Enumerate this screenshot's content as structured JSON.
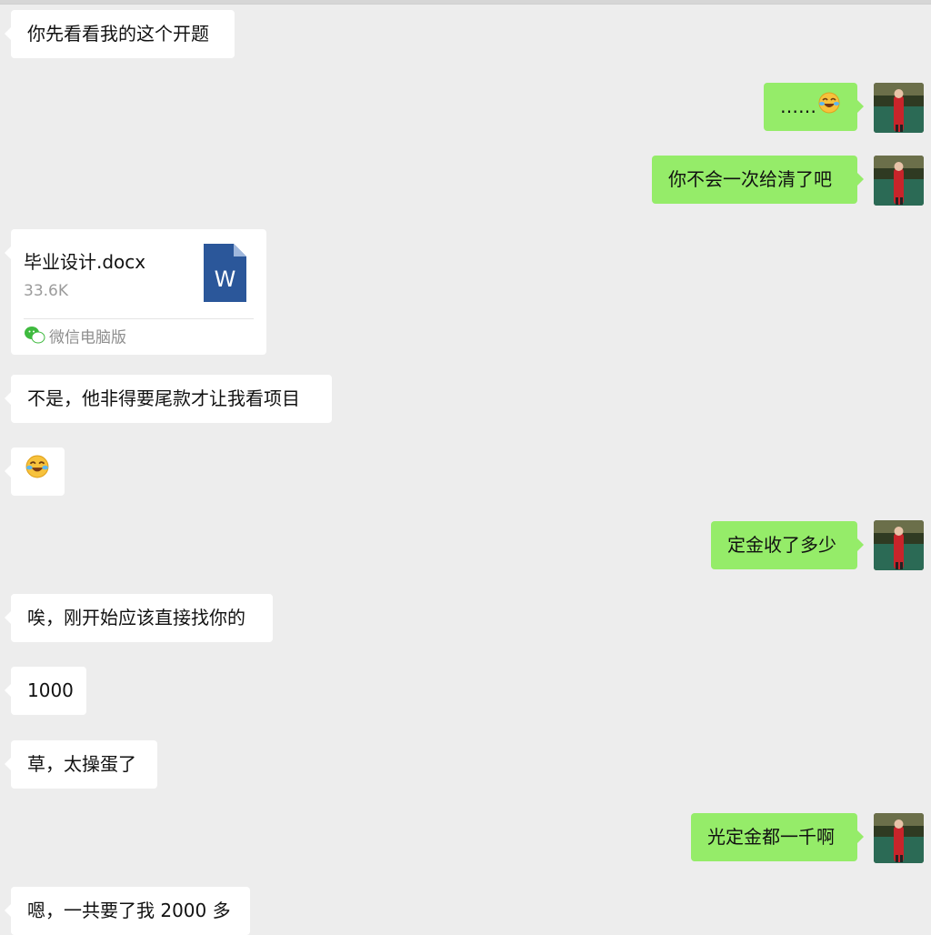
{
  "messages": [
    {
      "id": "m1",
      "side": "left",
      "text": "你先看看我的这个开题"
    },
    {
      "id": "m2",
      "side": "right",
      "text": "……",
      "emoji": "laughing-crying-emoji"
    },
    {
      "id": "m3",
      "side": "right",
      "text": "你不会一次给清了吧"
    },
    {
      "id": "m4",
      "side": "left",
      "type": "file",
      "file": {
        "name": "毕业设计.docx",
        "size": "33.6K",
        "icon": "word-doc-icon",
        "letter": "W",
        "source": "微信电脑版"
      }
    },
    {
      "id": "m5",
      "side": "left",
      "text": "不是，他非得要尾款才让我看项目"
    },
    {
      "id": "m6",
      "side": "left",
      "emoji": "laughing-crying-emoji"
    },
    {
      "id": "m7",
      "side": "right",
      "text": "定金收了多少"
    },
    {
      "id": "m8",
      "side": "left",
      "text": "唉，刚开始应该直接找你的"
    },
    {
      "id": "m9",
      "side": "left",
      "text": "1000"
    },
    {
      "id": "m10",
      "side": "left",
      "text": "草，太操蛋了"
    },
    {
      "id": "m11",
      "side": "right",
      "text": "光定金都一千啊"
    },
    {
      "id": "m12",
      "side": "left",
      "text": "嗯，一共要了我 2000 多"
    }
  ],
  "colors": {
    "background": "#ededed",
    "incoming_bubble": "#ffffff",
    "outgoing_bubble": "#95ec69",
    "word_icon": "#2b579a"
  }
}
